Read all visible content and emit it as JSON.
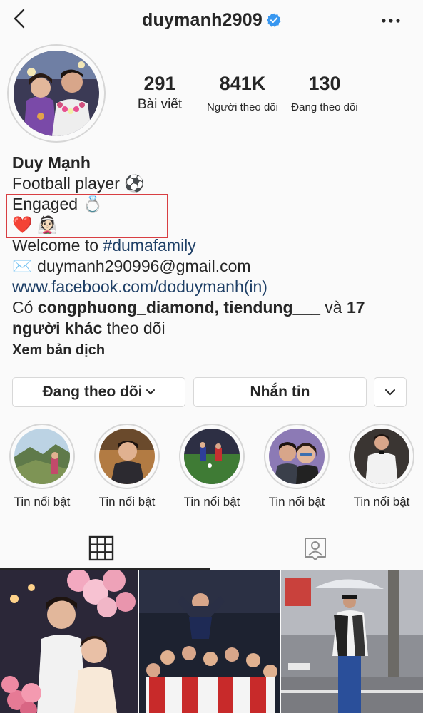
{
  "header": {
    "username": "duymanh2909",
    "icons": {
      "back": "chevron-left-icon",
      "verified": "verified-badge-icon",
      "more": "more-horizontal-icon"
    }
  },
  "stats": [
    {
      "value": "291",
      "label": "Bài viết"
    },
    {
      "value": "841K",
      "label": "Người theo dõi"
    },
    {
      "value": "130",
      "label": "Đang theo dõi"
    }
  ],
  "bio": {
    "name": "Duy Mạnh",
    "line1_text": "Football player",
    "line1_emoji": "⚽",
    "line2_text": "Engaged",
    "line2_emoji": "💍",
    "line3_emojis": "❤️ 👰🏻",
    "welcome_prefix": "Welcome to ",
    "hashtag": "#dumafamily",
    "email_icon": "✉️",
    "email": "duymanh290996@gmail.com",
    "website": "www.facebook.com/doduymanh(in)",
    "followed_prefix": "Có ",
    "followed_by_accounts": "congphuong_diamond, tiendung___",
    "followed_and": " và ",
    "followed_count": "17",
    "followed_others": "người khác",
    "followed_suffix": " theo dõi",
    "translate_label": "Xem bản dịch"
  },
  "actions": {
    "following_label": "Đang theo dõi",
    "message_label": "Nhắn tin"
  },
  "highlights": [
    {
      "label": "Tin nổi bật"
    },
    {
      "label": "Tin nổi bật"
    },
    {
      "label": "Tin nổi bật"
    },
    {
      "label": "Tin nổi bật"
    },
    {
      "label": "Tin nổi bật"
    }
  ],
  "tabs": [
    {
      "icon": "grid-icon",
      "active": true
    },
    {
      "icon": "tagged-person-icon",
      "active": false
    }
  ],
  "colors": {
    "accent_blue": "#3897f0",
    "link": "#1e3f66",
    "highlight_box": "#d83e42",
    "text": "#262626"
  }
}
